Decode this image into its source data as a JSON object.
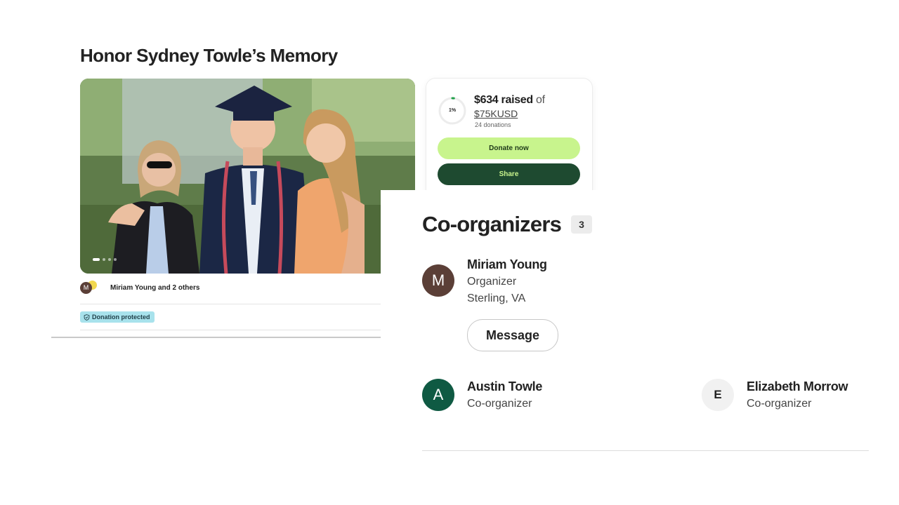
{
  "page": {
    "title": "Honor Sydney Towle’s Memory"
  },
  "fundraiser": {
    "organizer_line": "Miriam Young and 2 others",
    "organizer_initial": "M",
    "donation_protected": "Donation protected"
  },
  "donate_card": {
    "percent_label": "1%",
    "progress_fraction": 0.01,
    "raised": "$634 raised",
    "raised_of": "of",
    "goal": "$75KUSD",
    "donations": "24 donations",
    "donate_label": "Donate now",
    "share_label": "Share",
    "colors": {
      "donate_bg": "#c8f48d",
      "share_bg": "#1e4a30",
      "progress": "#22a04b"
    }
  },
  "coorganizers": {
    "title": "Co-organizers",
    "count": "3",
    "people": [
      {
        "initial": "M",
        "name": "Miriam Young",
        "role": "Organizer",
        "location": "Sterling, VA",
        "avatar_color": "#5b3f37"
      },
      {
        "initial": "A",
        "name": "Austin Towle",
        "role": "Co-organizer",
        "avatar_color": "#0f5a43"
      },
      {
        "initial": "E",
        "name": "Elizabeth Morrow",
        "role": "Co-organizer",
        "avatar_color": "#f1f1f1"
      }
    ],
    "message_label": "Message"
  }
}
